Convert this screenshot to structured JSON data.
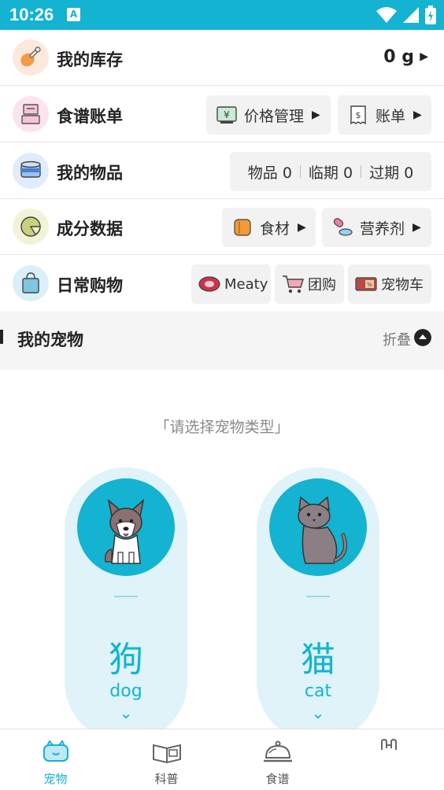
{
  "status_bar": {
    "time": "10:26",
    "notification": "A"
  },
  "menu": {
    "stock": {
      "label": "我的库存",
      "value": "0 g"
    },
    "recipe_bill": {
      "label": "食谱账单",
      "price_mgmt": "价格管理",
      "bill": "账单"
    },
    "items": {
      "label": "我的物品",
      "goods": "物品 0",
      "near_expiry": "临期 0",
      "expired": "过期 0"
    },
    "composition": {
      "label": "成分数据",
      "ingredients": "食材",
      "supplements": "营养剂"
    },
    "shopping": {
      "label": "日常购物",
      "meaty": "Meaty",
      "group_buy": "团购",
      "pet_car": "宠物车"
    }
  },
  "section": {
    "title": "我的宠物",
    "fold": "折叠"
  },
  "pet_select": {
    "prompt": "「请选择宠物类型」",
    "dog": {
      "cn": "狗",
      "en": "dog"
    },
    "cat": {
      "cn": "猫",
      "en": "cat"
    }
  },
  "tabs": [
    {
      "label": "宠物",
      "icon": "pet-icon",
      "active": true
    },
    {
      "label": "科普",
      "icon": "book-icon",
      "active": false
    },
    {
      "label": "食谱",
      "icon": "cloche-icon",
      "active": false
    },
    {
      "label": "",
      "icon": "bag-icon",
      "active": false
    }
  ],
  "colors": {
    "accent": "#14b3d1",
    "card_bg": "#dff3f9",
    "section_bg": "#f5f5f5"
  }
}
